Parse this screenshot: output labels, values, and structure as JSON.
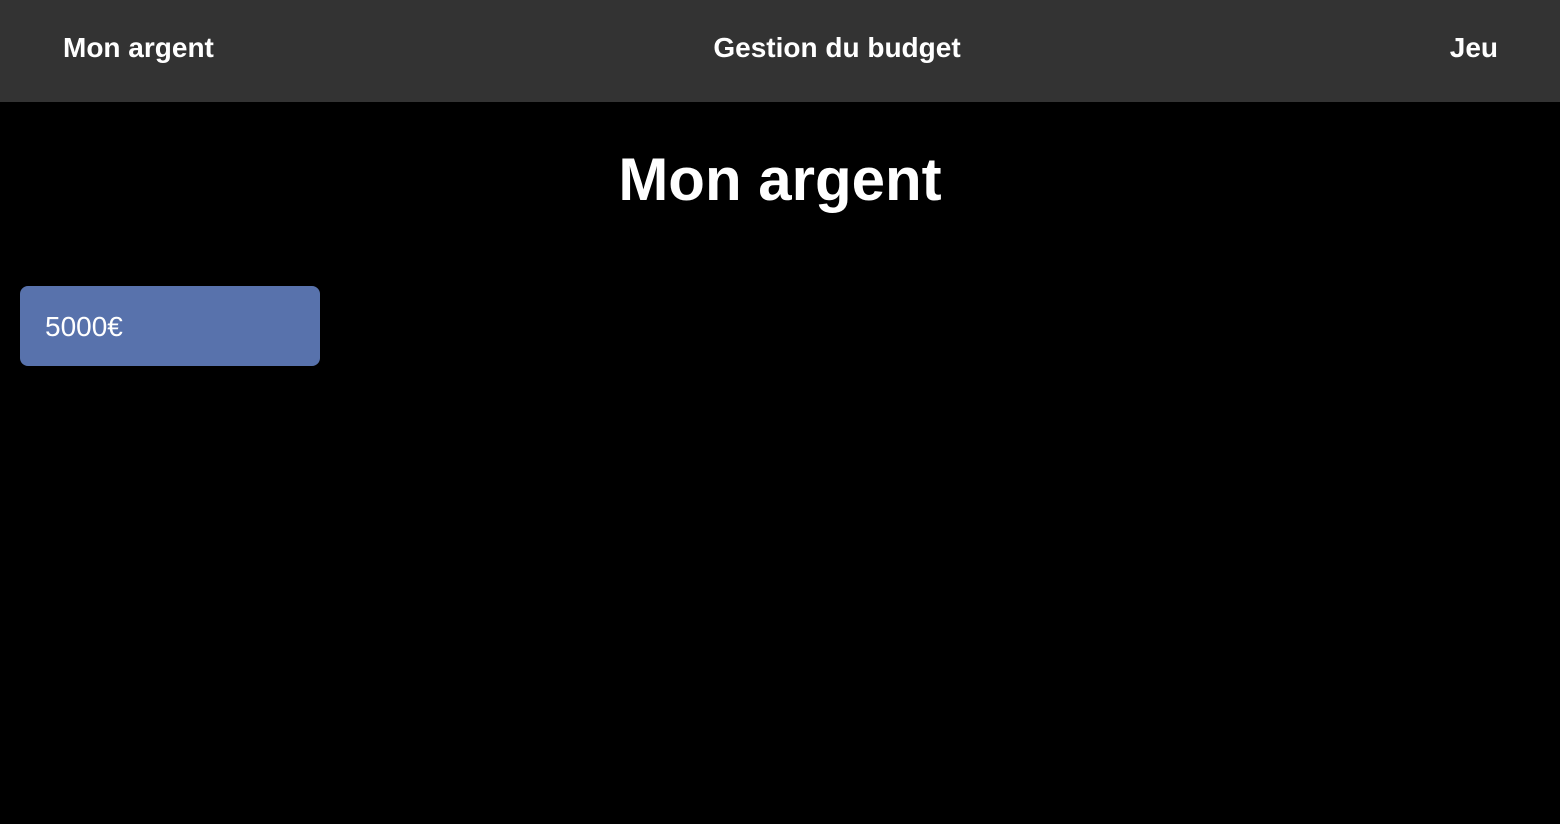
{
  "nav": {
    "left_label": "Mon argent",
    "center_label": "Gestion du budget",
    "right_label": "Jeu"
  },
  "main": {
    "title": "Mon argent",
    "balance": "5000€"
  },
  "colors": {
    "navbar_bg": "#333333",
    "page_bg": "#000000",
    "card_bg": "#5872ac",
    "text": "#ffffff"
  }
}
